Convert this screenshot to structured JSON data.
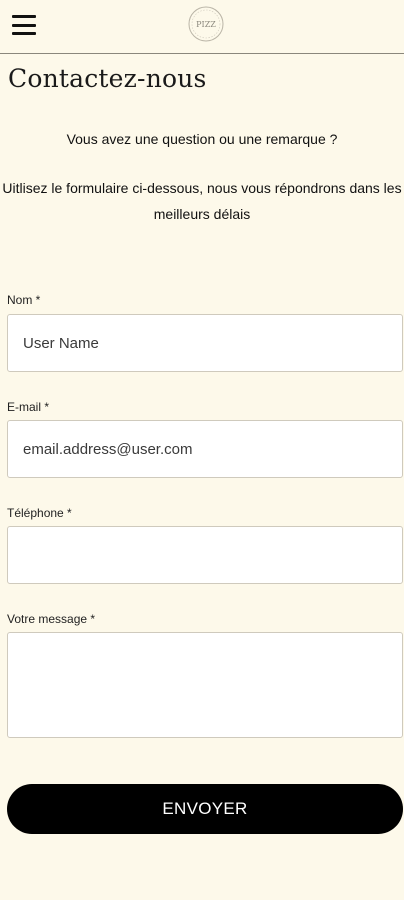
{
  "header": {
    "menu_icon": "hamburger-menu-icon",
    "logo_text": "PIZZ"
  },
  "page": {
    "title": "Contactez-nous",
    "question": "Vous avez une question ou une remarque ?",
    "instructions": "Uitlisez le formulaire ci-dessous, nous vous répondrons dans les meilleurs délais"
  },
  "form": {
    "name": {
      "label": "Nom *",
      "placeholder": "User Name"
    },
    "email": {
      "label": "E-mail *",
      "placeholder": "email.address@user.com"
    },
    "phone": {
      "label": "Téléphone *",
      "placeholder": ""
    },
    "message": {
      "label": "Votre message *",
      "placeholder": ""
    },
    "submit_label": "ENVOYER"
  },
  "colors": {
    "background": "#fdf9ea",
    "button": "#000000",
    "button_text": "#ffffff"
  }
}
